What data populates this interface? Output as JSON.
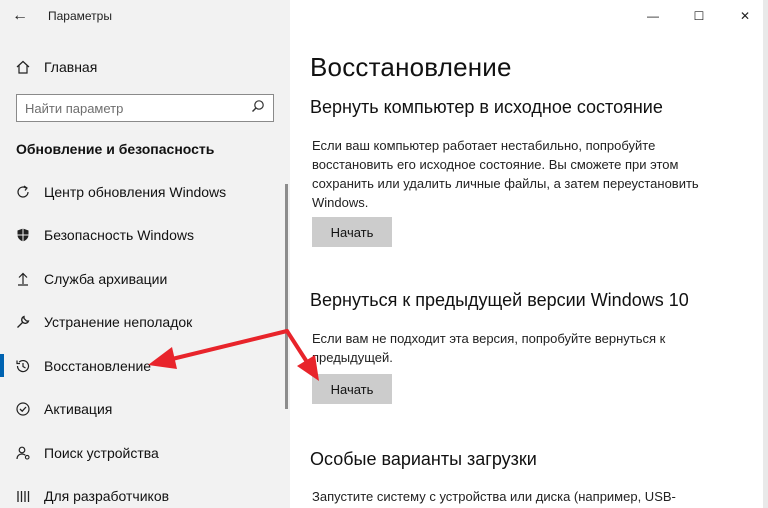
{
  "window": {
    "title": "Параметры",
    "back_label": "←",
    "minimize_label": "—",
    "maximize_label": "☐",
    "close_label": "✕"
  },
  "sidebar": {
    "home_label": "Главная",
    "search_placeholder": "Найти параметр",
    "section_heading": "Обновление и безопасность",
    "items": [
      {
        "label": "Центр обновления Windows",
        "icon": "refresh-icon"
      },
      {
        "label": "Безопасность Windows",
        "icon": "shield-icon"
      },
      {
        "label": "Служба архивации",
        "icon": "upload-icon"
      },
      {
        "label": "Устранение неполадок",
        "icon": "wrench-icon"
      },
      {
        "label": "Восстановление",
        "icon": "history-icon"
      },
      {
        "label": "Активация",
        "icon": "checkmark-circle-icon"
      },
      {
        "label": "Поиск устройства",
        "icon": "person-location-icon"
      },
      {
        "label": "Для разработчиков",
        "icon": "developer-bars-icon"
      }
    ],
    "active_index": 4
  },
  "main": {
    "page_title": "Восстановление",
    "sections": [
      {
        "title": "Вернуть компьютер в исходное состояние",
        "description": "Если ваш компьютер работает нестабильно, попробуйте восстановить его исходное состояние. Вы сможете при этом сохранить или удалить личные файлы, а затем переустановить Windows.",
        "button_label": "Начать"
      },
      {
        "title": "Вернуться к предыдущей версии Windows 10",
        "description": "Если вам не подходит эта версия, попробуйте вернуться к предыдущей.",
        "button_label": "Начать"
      },
      {
        "title": "Особые варианты загрузки",
        "description": "Запустите систему с устройства или диска (например, USB-"
      }
    ]
  },
  "colors": {
    "accent": "#0063b1",
    "arrow": "#e8242b",
    "sidebar_bg": "#f2f2f2",
    "button_bg": "#cccccc"
  }
}
